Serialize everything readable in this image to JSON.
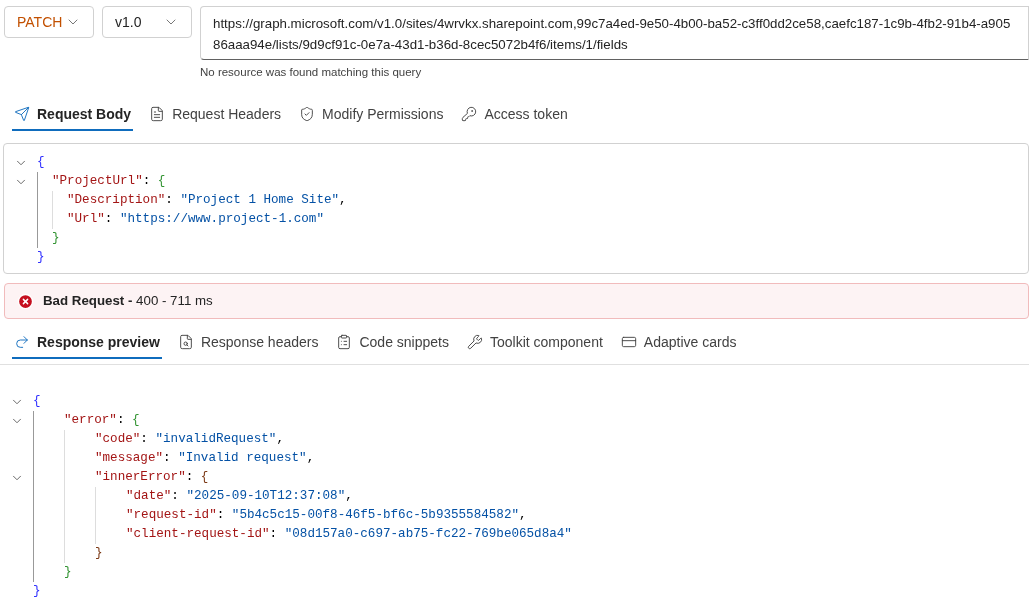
{
  "method": {
    "label": "PATCH"
  },
  "version": {
    "label": "v1.0"
  },
  "url": {
    "value": "https://graph.microsoft.com/v1.0/sites/4wrvkx.sharepoint.com,99c7a4ed-9e50-4b00-ba52-c3ff0dd2ce58,caefc187-1c9b-4fb2-91b4-a90586aaa94e/lists/9d9cf91c-0e7a-43d1-b36d-8cec5072b4f6/items/1/fields",
    "hint": "No resource was found matching this query"
  },
  "request_tabs": [
    {
      "label": "Request Body",
      "selected": true
    },
    {
      "label": "Request Headers",
      "selected": false
    },
    {
      "label": "Modify Permissions",
      "selected": false
    },
    {
      "label": "Access token",
      "selected": false
    }
  ],
  "request_body": {
    "code": {
      "kind": "block",
      "expanded": true,
      "open": [
        {
          "text": "{",
          "kind": "brace"
        }
      ],
      "close": [
        {
          "text": "}",
          "kind": "brace"
        }
      ],
      "children": [
        {
          "kind": "block",
          "expanded": true,
          "open": [
            {
              "text": "\"ProjectUrl\"",
              "kind": "key"
            },
            {
              "text": ": ",
              "kind": "punct"
            },
            {
              "text": "{",
              "kind": "brace"
            }
          ],
          "close": [
            {
              "text": "}",
              "kind": "brace"
            }
          ],
          "children": [
            {
              "kind": "line",
              "tokens": [
                {
                  "text": "\"Description\"",
                  "kind": "key"
                },
                {
                  "text": ": ",
                  "kind": "punct"
                },
                {
                  "text": "\"Project 1 Home Site\"",
                  "kind": "string"
                },
                {
                  "text": ",",
                  "kind": "punct"
                }
              ]
            },
            {
              "kind": "line",
              "tokens": [
                {
                  "text": "\"Url\"",
                  "kind": "key"
                },
                {
                  "text": ": ",
                  "kind": "punct"
                },
                {
                  "text": "\"https://www.project-1.com\"",
                  "kind": "string"
                }
              ]
            }
          ]
        }
      ]
    }
  },
  "status": {
    "kind": "error",
    "message": "**Bad Request -** 400 - 711 ms"
  },
  "response_tabs": [
    {
      "label": "Response preview",
      "selected": true
    },
    {
      "label": "Response headers",
      "selected": false
    },
    {
      "label": "Code snippets",
      "selected": false
    },
    {
      "label": "Toolkit component",
      "selected": false
    },
    {
      "label": "Adaptive cards",
      "selected": false
    }
  ],
  "response_preview": {
    "code": {
      "kind": "block",
      "expanded": true,
      "open": [
        {
          "text": "{",
          "kind": "brace"
        }
      ],
      "close": [
        {
          "text": "}",
          "kind": "brace"
        }
      ],
      "children": [
        {
          "kind": "block",
          "expanded": true,
          "open": [
            {
              "text": "\"error\"",
              "kind": "key"
            },
            {
              "text": ": ",
              "kind": "punct"
            },
            {
              "text": "{",
              "kind": "brace"
            }
          ],
          "close": [
            {
              "text": "}",
              "kind": "brace"
            }
          ],
          "children": [
            {
              "kind": "line",
              "tokens": [
                {
                  "text": "\"code\"",
                  "kind": "key"
                },
                {
                  "text": ": ",
                  "kind": "punct"
                },
                {
                  "text": "\"invalidRequest\"",
                  "kind": "string"
                },
                {
                  "text": ",",
                  "kind": "punct"
                }
              ]
            },
            {
              "kind": "line",
              "tokens": [
                {
                  "text": "\"message\"",
                  "kind": "key"
                },
                {
                  "text": ": ",
                  "kind": "punct"
                },
                {
                  "text": "\"Invalid request\"",
                  "kind": "string"
                },
                {
                  "text": ",",
                  "kind": "punct"
                }
              ]
            },
            {
              "kind": "block",
              "expanded": true,
              "open": [
                {
                  "text": "\"innerError\"",
                  "kind": "key"
                },
                {
                  "text": ": ",
                  "kind": "punct"
                },
                {
                  "text": "{",
                  "kind": "brace"
                }
              ],
              "close": [
                {
                  "text": "}",
                  "kind": "brace"
                }
              ],
              "children": [
                {
                  "kind": "line",
                  "tokens": [
                    {
                      "text": "\"date\"",
                      "kind": "key"
                    },
                    {
                      "text": ": ",
                      "kind": "punct"
                    },
                    {
                      "text": "\"2025-09-10T12:37:08\"",
                      "kind": "string"
                    },
                    {
                      "text": ",",
                      "kind": "punct"
                    }
                  ]
                },
                {
                  "kind": "line",
                  "tokens": [
                    {
                      "text": "\"request-id\"",
                      "kind": "key"
                    },
                    {
                      "text": ": ",
                      "kind": "punct"
                    },
                    {
                      "text": "\"5b4c5c15-00f8-46f5-bf6c-5b9355584582\"",
                      "kind": "string"
                    },
                    {
                      "text": ",",
                      "kind": "punct"
                    }
                  ]
                },
                {
                  "kind": "line",
                  "tokens": [
                    {
                      "text": "\"client-request-id\"",
                      "kind": "key"
                    },
                    {
                      "text": ": ",
                      "kind": "punct"
                    },
                    {
                      "text": "\"08d157a0-c697-ab75-fc22-769be065d8a4\"",
                      "kind": "string"
                    }
                  ]
                }
              ]
            }
          ]
        }
      ]
    }
  }
}
